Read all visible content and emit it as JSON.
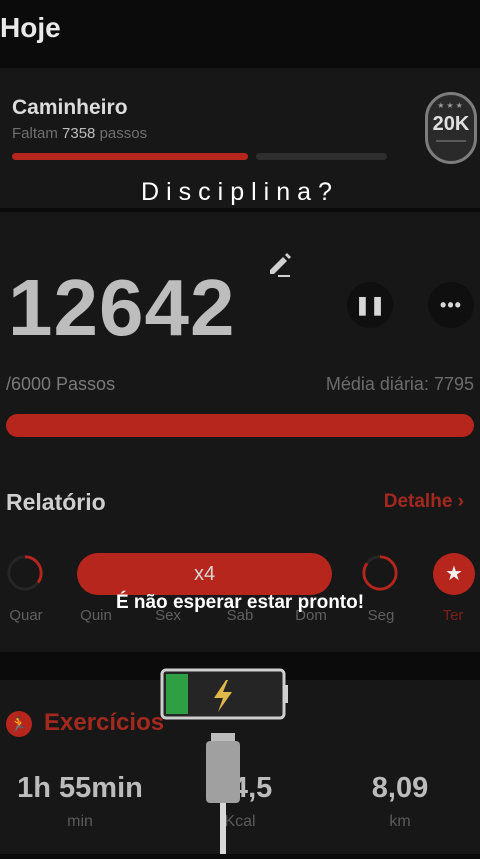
{
  "header": {
    "title": "Hoje"
  },
  "achievement": {
    "title": "Caminheiro",
    "remaining_prefix": "Faltam",
    "remaining_value": "7358",
    "remaining_suffix": "passos",
    "progress": 0.63,
    "badge_label": "20K"
  },
  "overlay": {
    "title": "Disciplina?",
    "caption": "É não esperar estar pronto!"
  },
  "steps": {
    "count": "12642",
    "goal_label": "/6000 Passos",
    "daily_avg_label": "Média diária: 7795",
    "progress": 1.0,
    "pause_icon": "pause-icon",
    "more_icon": "more-icon"
  },
  "report": {
    "title": "Relatório",
    "detail_link": "Detalhe",
    "streak_label": "x4",
    "days": [
      {
        "label": "Quar",
        "progress": 0.35
      },
      {
        "label": "Quin",
        "progress": 1.0
      },
      {
        "label": "Sex",
        "progress": 1.0
      },
      {
        "label": "Sab",
        "progress": 1.0
      },
      {
        "label": "Dom",
        "progress": 1.0
      },
      {
        "label": "Seg",
        "progress": 0.85
      },
      {
        "label": "Ter",
        "progress": 1.0
      }
    ]
  },
  "exercises": {
    "title": "Exercícios",
    "stats": [
      {
        "value": "1h 55min",
        "unit": "min"
      },
      {
        "value": "4 4,5",
        "unit": "Kcal"
      },
      {
        "value": "8,09",
        "unit": "km"
      }
    ]
  },
  "colors": {
    "accent": "#b7261c",
    "background": "#0b0b0b",
    "card": "#171717",
    "battery_green": "#2ea043"
  }
}
